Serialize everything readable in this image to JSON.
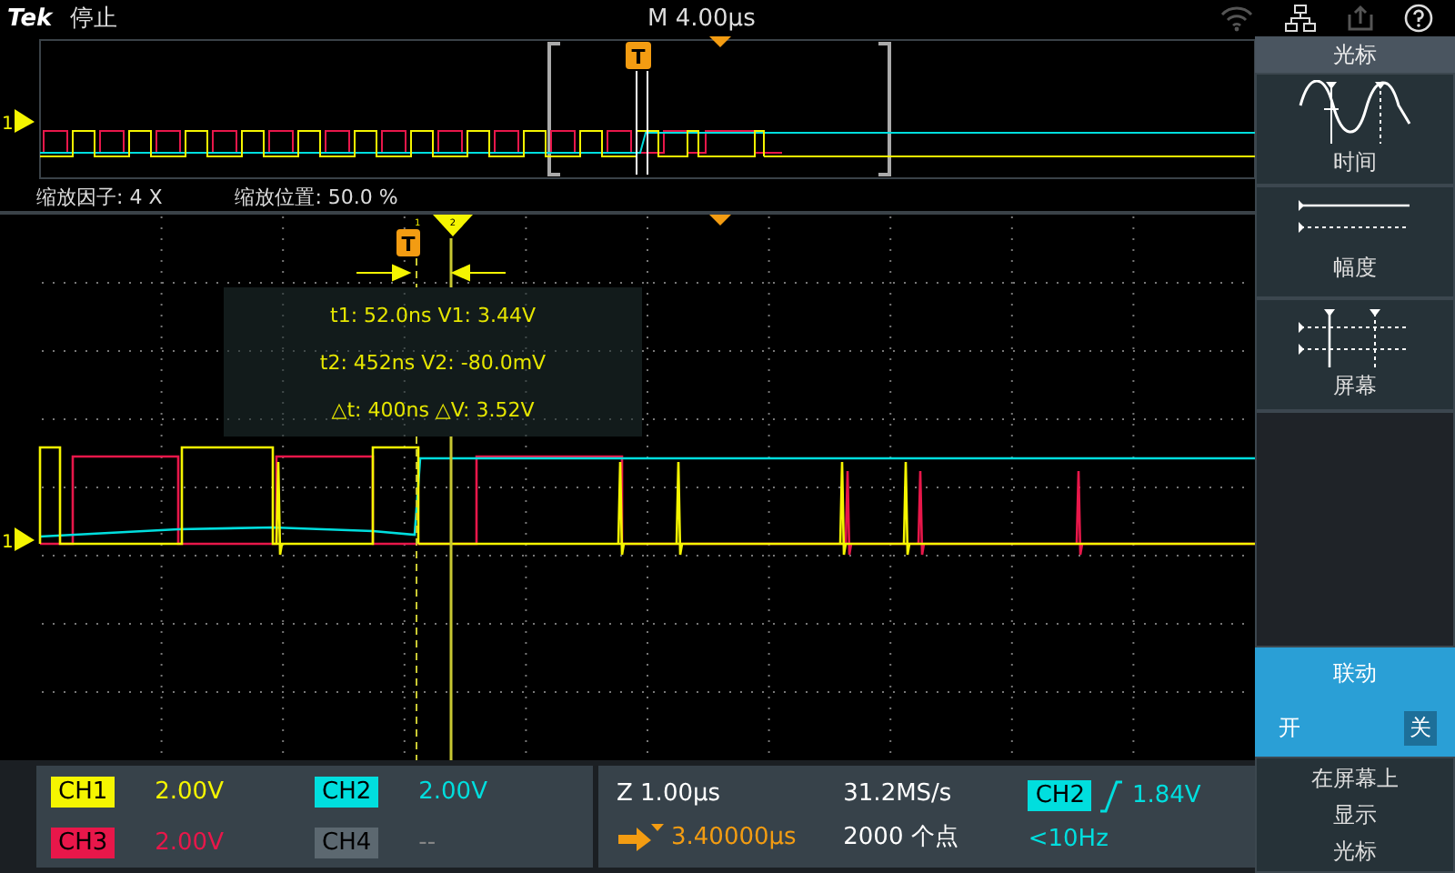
{
  "header": {
    "brand": "Tek",
    "status": "停止",
    "timebase": "M 4.00µs"
  },
  "overview": {
    "channel_marker": "1",
    "trigger_marker": "T"
  },
  "zoom_info": {
    "factor": "缩放因子: 4 X",
    "position": "缩放位置: 50.0 %"
  },
  "main": {
    "channel_marker": "1",
    "trigger_marker": "T",
    "cursor_1_marker": "1",
    "cursor_2_marker": "2",
    "readout": [
      "t1: 52.0ns  V1: 3.44V",
      "t2: 452ns  V2: -80.0mV",
      "△t: 400ns  △V: 3.52V"
    ]
  },
  "side_menu": {
    "title": "光标",
    "items": [
      {
        "kind": "time",
        "label": "时间"
      },
      {
        "kind": "amplitude",
        "label": "幅度"
      },
      {
        "kind": "screen",
        "label": "屏幕"
      }
    ],
    "link": {
      "label": "联动",
      "options": [
        {
          "label": "开",
          "selected": false
        },
        {
          "label": "关",
          "selected": true
        }
      ]
    },
    "footer": [
      "在屏幕上",
      "显示",
      "光标"
    ]
  },
  "channels": [
    {
      "label": "CH1",
      "scale": "2.00V",
      "color": "#f5f500"
    },
    {
      "label": "CH2",
      "scale": "2.00V",
      "color": "#00dede"
    },
    {
      "label": "CH3",
      "scale": "2.00V",
      "color": "#e8174a"
    },
    {
      "label": "CH4",
      "scale": "--",
      "color": "#5c6870"
    }
  ],
  "horizontal": {
    "zoom_scale": "Z 1.00µs",
    "position": "3.40000µs",
    "sample_rate": "31.2MS/s",
    "record_length": "2000 个点"
  },
  "trigger": {
    "source": "CH2",
    "level": "1.84V",
    "frequency": "<10Hz"
  }
}
